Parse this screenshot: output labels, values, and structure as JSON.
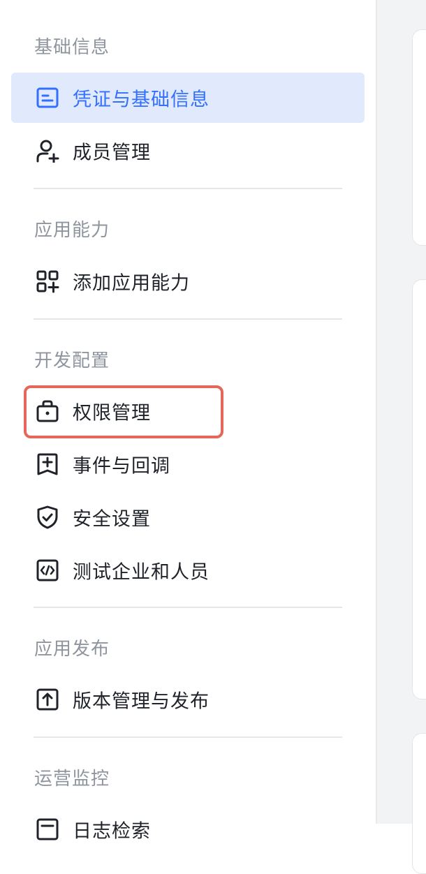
{
  "sidebar": {
    "sections": [
      {
        "title": "基础信息",
        "items": [
          {
            "label": "凭证与基础信息",
            "icon": "credential-card-icon",
            "active": true
          },
          {
            "label": "成员管理",
            "icon": "user-add-icon",
            "active": false
          }
        ]
      },
      {
        "title": "应用能力",
        "items": [
          {
            "label": "添加应用能力",
            "icon": "apps-add-icon",
            "active": false
          }
        ]
      },
      {
        "title": "开发配置",
        "items": [
          {
            "label": "权限管理",
            "icon": "briefcase-lock-icon",
            "active": false
          },
          {
            "label": "事件与回调",
            "icon": "event-add-icon",
            "active": false
          },
          {
            "label": "安全设置",
            "icon": "shield-check-icon",
            "active": false
          },
          {
            "label": "测试企业和人员",
            "icon": "code-window-icon",
            "active": false
          }
        ]
      },
      {
        "title": "应用发布",
        "items": [
          {
            "label": "版本管理与发布",
            "icon": "upload-box-icon",
            "active": false
          }
        ]
      },
      {
        "title": "运营监控",
        "items": [
          {
            "label": "日志检索",
            "icon": "log-search-icon",
            "active": false
          }
        ]
      }
    ]
  },
  "colors": {
    "accent": "#3370ff",
    "active_bg": "#e1e9fc",
    "section_title": "#8f959e",
    "text": "#1f2329",
    "highlight_border": "#e5675a"
  }
}
